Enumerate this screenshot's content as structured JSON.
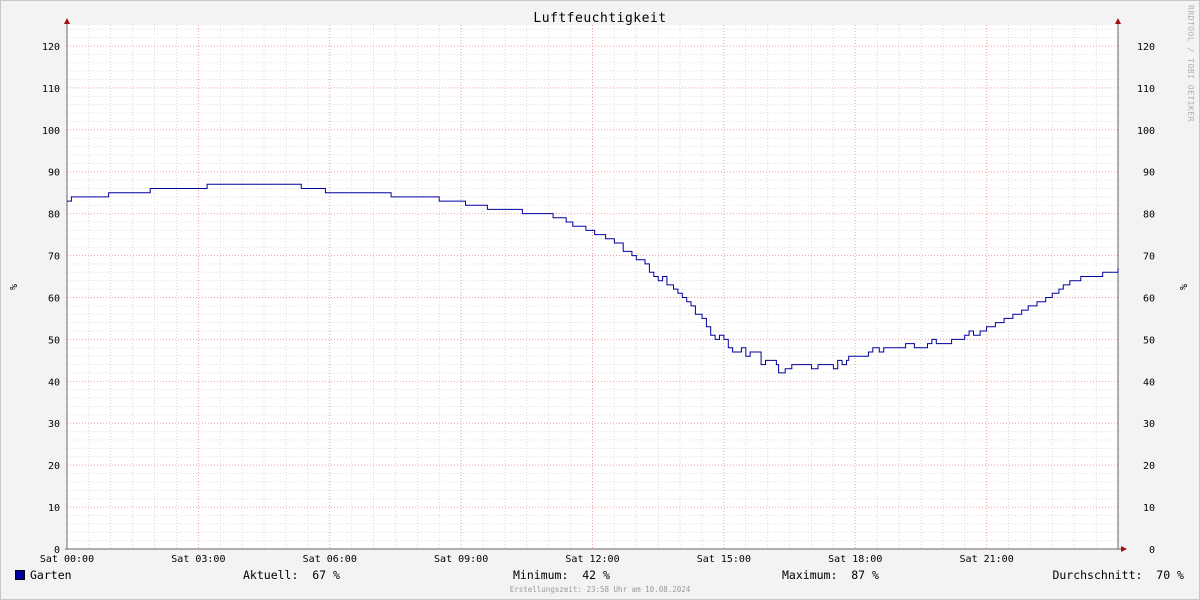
{
  "chart_data": {
    "type": "line",
    "title": "Luftfeuchtigkeit",
    "ylabel": "%",
    "ylabel_right": "%",
    "ylim": [
      0,
      125
    ],
    "yticks": [
      0,
      10,
      20,
      30,
      40,
      50,
      60,
      70,
      80,
      90,
      100,
      110,
      120
    ],
    "xlim": [
      0,
      24
    ],
    "xticks": [
      {
        "x": 0,
        "label": "Sat 00:00"
      },
      {
        "x": 3,
        "label": "Sat 03:00"
      },
      {
        "x": 6,
        "label": "Sat 06:00"
      },
      {
        "x": 9,
        "label": "Sat 09:00"
      },
      {
        "x": 12,
        "label": "Sat 12:00"
      },
      {
        "x": 15,
        "label": "Sat 15:00"
      },
      {
        "x": 18,
        "label": "Sat 18:00"
      },
      {
        "x": 21,
        "label": "Sat 21:00"
      }
    ],
    "grid": true,
    "series": [
      {
        "name": "Garten",
        "color": "#0000a0",
        "points": [
          [
            0.0,
            83
          ],
          [
            0.1,
            84
          ],
          [
            0.95,
            85
          ],
          [
            1.9,
            86
          ],
          [
            3.2,
            87
          ],
          [
            5.35,
            86
          ],
          [
            5.9,
            85
          ],
          [
            7.4,
            84
          ],
          [
            8.5,
            83
          ],
          [
            9.1,
            82
          ],
          [
            9.6,
            81
          ],
          [
            10.4,
            80
          ],
          [
            11.1,
            79
          ],
          [
            11.4,
            78
          ],
          [
            11.55,
            77
          ],
          [
            11.85,
            76
          ],
          [
            12.05,
            75
          ],
          [
            12.3,
            74
          ],
          [
            12.5,
            73
          ],
          [
            12.7,
            71
          ],
          [
            12.9,
            70
          ],
          [
            13.0,
            69
          ],
          [
            13.2,
            68
          ],
          [
            13.3,
            66
          ],
          [
            13.4,
            65
          ],
          [
            13.5,
            64
          ],
          [
            13.6,
            65
          ],
          [
            13.7,
            63
          ],
          [
            13.85,
            62
          ],
          [
            13.95,
            61
          ],
          [
            14.05,
            60
          ],
          [
            14.15,
            59
          ],
          [
            14.25,
            58
          ],
          [
            14.35,
            56
          ],
          [
            14.5,
            55
          ],
          [
            14.6,
            53
          ],
          [
            14.7,
            51
          ],
          [
            14.8,
            50
          ],
          [
            14.9,
            51
          ],
          [
            15.0,
            50
          ],
          [
            15.1,
            48
          ],
          [
            15.2,
            47
          ],
          [
            15.3,
            47
          ],
          [
            15.4,
            48
          ],
          [
            15.5,
            46
          ],
          [
            15.6,
            47
          ],
          [
            15.75,
            47
          ],
          [
            15.85,
            44
          ],
          [
            15.95,
            45
          ],
          [
            16.1,
            45
          ],
          [
            16.2,
            44
          ],
          [
            16.25,
            42
          ],
          [
            16.4,
            43
          ],
          [
            16.55,
            44
          ],
          [
            16.9,
            44
          ],
          [
            17.0,
            43
          ],
          [
            17.15,
            44
          ],
          [
            17.4,
            44
          ],
          [
            17.5,
            43
          ],
          [
            17.6,
            45
          ],
          [
            17.7,
            44
          ],
          [
            17.8,
            45
          ],
          [
            17.85,
            46
          ],
          [
            17.95,
            46
          ],
          [
            18.3,
            47
          ],
          [
            18.4,
            48
          ],
          [
            18.55,
            47
          ],
          [
            18.65,
            48
          ],
          [
            19.05,
            48
          ],
          [
            19.15,
            49
          ],
          [
            19.35,
            48
          ],
          [
            19.65,
            49
          ],
          [
            19.75,
            50
          ],
          [
            19.85,
            49
          ],
          [
            20.2,
            50
          ],
          [
            20.5,
            51
          ],
          [
            20.6,
            52
          ],
          [
            20.7,
            51
          ],
          [
            20.85,
            52
          ],
          [
            21.0,
            53
          ],
          [
            21.2,
            54
          ],
          [
            21.4,
            55
          ],
          [
            21.6,
            56
          ],
          [
            21.8,
            57
          ],
          [
            21.95,
            58
          ],
          [
            22.15,
            59
          ],
          [
            22.35,
            60
          ],
          [
            22.5,
            61
          ],
          [
            22.65,
            62
          ],
          [
            22.75,
            63
          ],
          [
            22.9,
            64
          ],
          [
            23.15,
            65
          ],
          [
            23.65,
            66
          ],
          [
            24.0,
            67
          ]
        ]
      }
    ]
  },
  "legend": {
    "series_name": "Garten",
    "current": "Aktuell:  67 %",
    "minimum": "Minimum:  42 %",
    "maximum": "Maximum:  87 %",
    "average": "Durchschnitt:  70 %"
  },
  "watermark": "RRDTOOL / TOBI OETIKER",
  "footer": "Erstellungszeit: 23:58 Uhr am 10.08.2024"
}
